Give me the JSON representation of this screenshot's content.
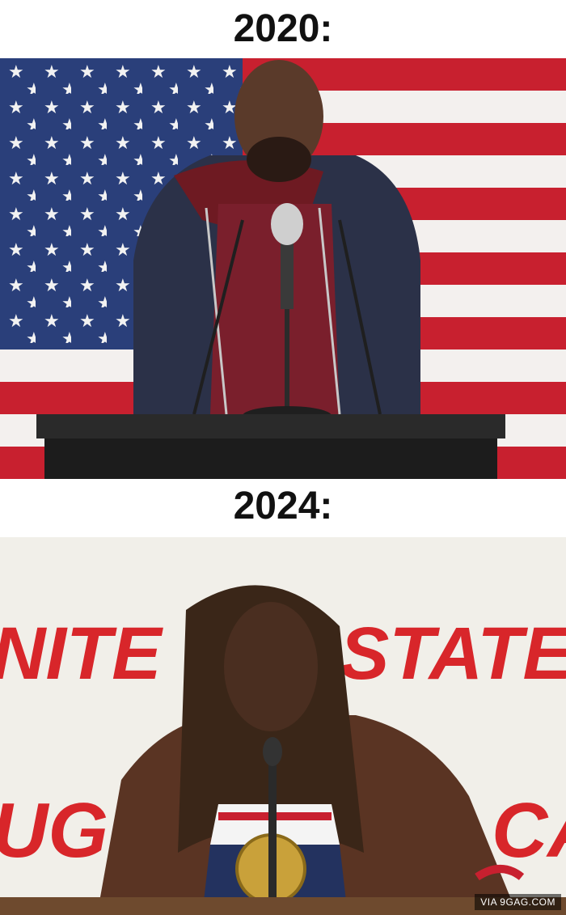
{
  "captions": {
    "top": "2020:",
    "bottom": "2024:"
  },
  "banner": {
    "text_top_part1": "NITE",
    "text_top_part2": "STATES",
    "text_bottom_part1": "UGO",
    "text_bottom_part2": "ALCA"
  },
  "watermark": "VIA 9GAG.COM",
  "colors": {
    "flag_red": "#c8202f",
    "flag_blue": "#2a3f7a",
    "banner_red": "#d8262a",
    "podium": "#222222"
  }
}
